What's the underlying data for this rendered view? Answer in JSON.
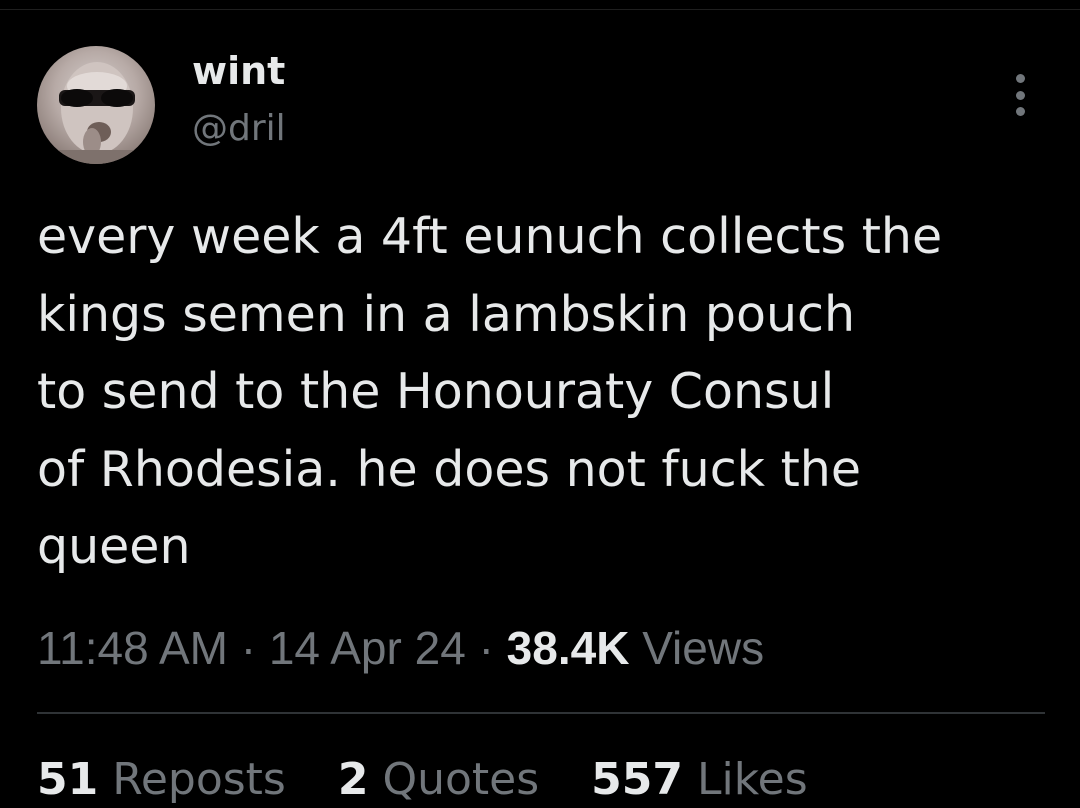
{
  "user": {
    "display_name": "wint",
    "handle": "@dril",
    "avatar_icon": "profile-photo"
  },
  "more_icon": "more-options-icon",
  "tweet": {
    "lines": [
      "every week a 4ft eunuch collects the",
      "kings semen in a lambskin pouch",
      "to send to the Honouraty Consul",
      "of Rhodesia. he does not fuck the",
      "queen"
    ]
  },
  "meta": {
    "time": "11:48 AM",
    "date": "14 Apr 24",
    "separator": "·",
    "views_count": "38.4K",
    "views_label": "Views"
  },
  "stats": {
    "reposts_count": "51",
    "reposts_label": "Reposts",
    "quotes_count": "2",
    "quotes_label": "Quotes",
    "likes_count": "557",
    "likes_label": "Likes"
  },
  "colors": {
    "background": "#000000",
    "primary_text": "#e7e9ea",
    "secondary_text": "#71767b",
    "divider": "#2f3336"
  }
}
